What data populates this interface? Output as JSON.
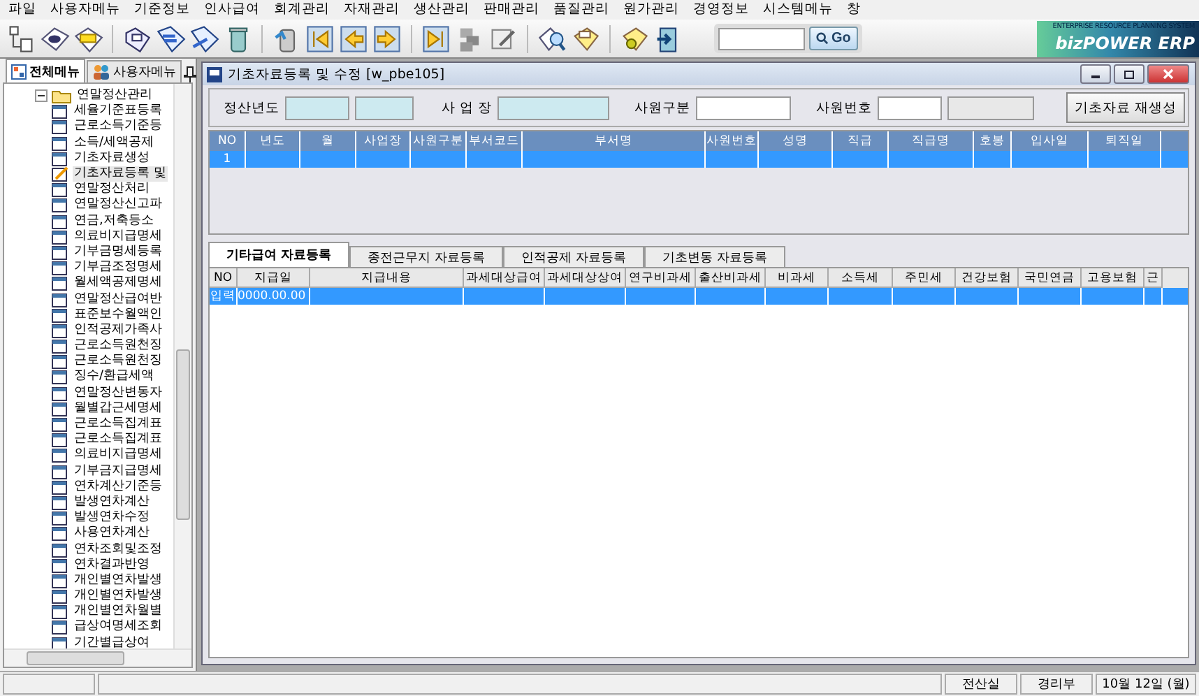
{
  "menu_bar": [
    "파일",
    "사용자메뉴",
    "기준정보",
    "인사급여",
    "회계관리",
    "자재관리",
    "생산관리",
    "판매관리",
    "품질관리",
    "원가관리",
    "경영정보",
    "시스템메뉴",
    "창"
  ],
  "toolbar": {
    "search": {
      "button": "Go"
    },
    "logo": {
      "tagline": "ENTERPRISE RESOURCE PLANNING SYSTEM",
      "name": "bizPOWER ERP"
    }
  },
  "sidebar": {
    "tabs": [
      {
        "label": "전체메뉴",
        "selected": true
      },
      {
        "label": "사용자메뉴",
        "selected": false
      }
    ],
    "tree": [
      {
        "label": "연말정산관리",
        "expanded": true,
        "children": [
          {
            "label": "세율기준표등록",
            "selected": false
          },
          {
            "label": "근로소득기준등",
            "selected": false
          },
          {
            "label": "소득/세액공제",
            "selected": false
          },
          {
            "label": "기초자료생성",
            "selected": false
          },
          {
            "label": "기초자료등록 및",
            "selected": true
          },
          {
            "label": "연말정산처리",
            "selected": false
          },
          {
            "label": "연말정산신고파",
            "selected": false
          },
          {
            "label": "연금,저축등소",
            "selected": false
          },
          {
            "label": "의료비지급명세",
            "selected": false
          },
          {
            "label": "기부금명세등록",
            "selected": false
          },
          {
            "label": "기부금조정명세",
            "selected": false
          },
          {
            "label": "월세액공제명세",
            "selected": false
          },
          {
            "label": "연말정산급여반",
            "selected": false
          },
          {
            "label": "표준보수월액인",
            "selected": false
          },
          {
            "label": "인적공제가족사",
            "selected": false
          },
          {
            "label": "근로소득원천징",
            "selected": false
          },
          {
            "label": "근로소득원천징",
            "selected": false
          },
          {
            "label": "징수/환급세액",
            "selected": false
          },
          {
            "label": "연말정산변동자",
            "selected": false
          },
          {
            "label": "월별갑근세명세",
            "selected": false
          },
          {
            "label": "근로소득집계표",
            "selected": false
          },
          {
            "label": "근로소득집계표",
            "selected": false
          },
          {
            "label": "의료비지급명세",
            "selected": false
          },
          {
            "label": "기부금지급명세",
            "selected": false
          },
          {
            "label": "연차계산기준등",
            "selected": false
          },
          {
            "label": "발생연차계산",
            "selected": false
          },
          {
            "label": "발생연차수정",
            "selected": false
          },
          {
            "label": "사용연차계산",
            "selected": false
          },
          {
            "label": "연차조회및조정",
            "selected": false
          },
          {
            "label": "연차결과반영",
            "selected": false
          },
          {
            "label": "개인별연차발생",
            "selected": false
          },
          {
            "label": "개인별연차발생",
            "selected": false
          },
          {
            "label": "개인별연차월별",
            "selected": false
          },
          {
            "label": "급상여명세조회",
            "selected": false
          },
          {
            "label": "기간별급상여",
            "selected": false
          }
        ]
      }
    ]
  },
  "window": {
    "title": "기초자료등록 및 수정 [w_pbe105]",
    "form": {
      "year_label": "정산년도",
      "site_label": "사 업 장",
      "type_label": "사원구분",
      "number_label": "사원번호",
      "button": "기초자료 재생성"
    },
    "table": {
      "columns": [
        "NO",
        "년도",
        "월",
        "사업장",
        "사원구분",
        "부서코드",
        "부서명",
        "사원번호",
        "성명",
        "직급",
        "직급명",
        "호봉",
        "입사일",
        "퇴직일"
      ],
      "rows": [
        {
          "selected": true,
          "cells": [
            "1",
            "",
            "",
            "",
            "",
            "",
            "",
            "",
            "",
            "",
            "",
            "",
            "",
            ""
          ]
        }
      ]
    },
    "tabs": [
      {
        "label": "기타급여 자료등록",
        "selected": true
      },
      {
        "label": "종전근무지 자료등록",
        "selected": false
      },
      {
        "label": "인적공제 자료등록",
        "selected": false
      },
      {
        "label": "기초변동 자료등록",
        "selected": false
      }
    ],
    "detail_table": {
      "columns": [
        "NO",
        "지급일",
        "지급내용",
        "과세대상급여",
        "과세대상상여",
        "연구비과세",
        "출산비과세",
        "비과세",
        "소득세",
        "주민세",
        "건강보험",
        "국민연금",
        "고용보험",
        "근"
      ],
      "rows": [
        {
          "selected": true,
          "cells": [
            "입력",
            "0000.00.00",
            "",
            "",
            "",
            "",
            "",
            "",
            "",
            "",
            "",
            "",
            "",
            ""
          ]
        }
      ]
    }
  },
  "status_bar": [
    "전산실",
    "경리부",
    "10월 12일 (월)"
  ]
}
